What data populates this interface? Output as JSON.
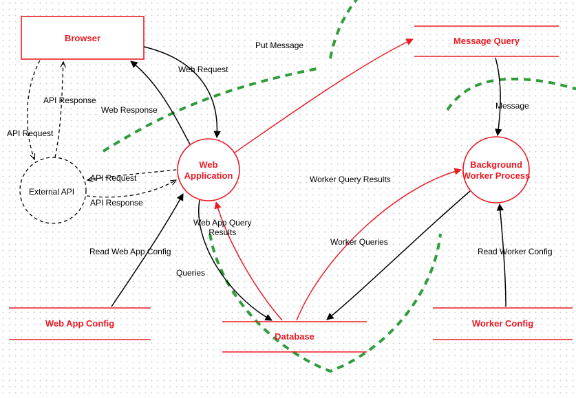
{
  "nodes": {
    "browser": "Browser",
    "web_app": "Web\nApplication",
    "message_query": "Message Query",
    "bg_worker": "Background\nWorker Process",
    "database": "Database",
    "web_app_config": "Web App Config",
    "worker_config": "Worker Config",
    "external_api": "External API"
  },
  "edges": {
    "web_request": "Web Request",
    "web_response": "Web Response",
    "api_request_browser": "API Request",
    "api_response_browser": "API Response",
    "api_request_app": "API Request",
    "api_response_app": "API Response",
    "put_message": "Put Message",
    "message": "Message",
    "worker_query_results": "Worker Query Results",
    "worker_queries": "Worker Queries",
    "queries": "Queries",
    "web_app_query_results": "Web App Query\nResults",
    "read_web_app_config": "Read Web App Config",
    "read_worker_config": "Read Worker Config"
  }
}
